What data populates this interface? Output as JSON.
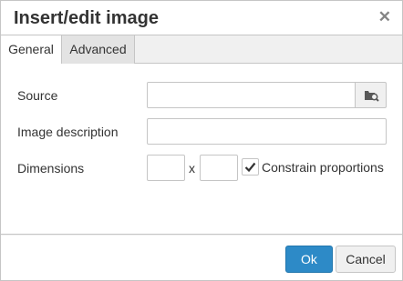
{
  "dialog": {
    "title": "Insert/edit image",
    "close_icon": "close-icon"
  },
  "tabs": [
    {
      "label": "General",
      "active": true
    },
    {
      "label": "Advanced",
      "active": false
    }
  ],
  "form": {
    "source": {
      "label": "Source",
      "value": "",
      "browse_icon": "folder-search-icon"
    },
    "description": {
      "label": "Image description",
      "value": ""
    },
    "dimensions": {
      "label": "Dimensions",
      "width": "",
      "height": "",
      "separator": "x"
    },
    "constrain": {
      "label": "Constrain proportions",
      "checked": true
    }
  },
  "buttons": {
    "ok": "Ok",
    "cancel": "Cancel"
  },
  "colors": {
    "primary": "#2d8ac7",
    "border": "#c5c5c5",
    "panel": "#f0f0f0"
  }
}
